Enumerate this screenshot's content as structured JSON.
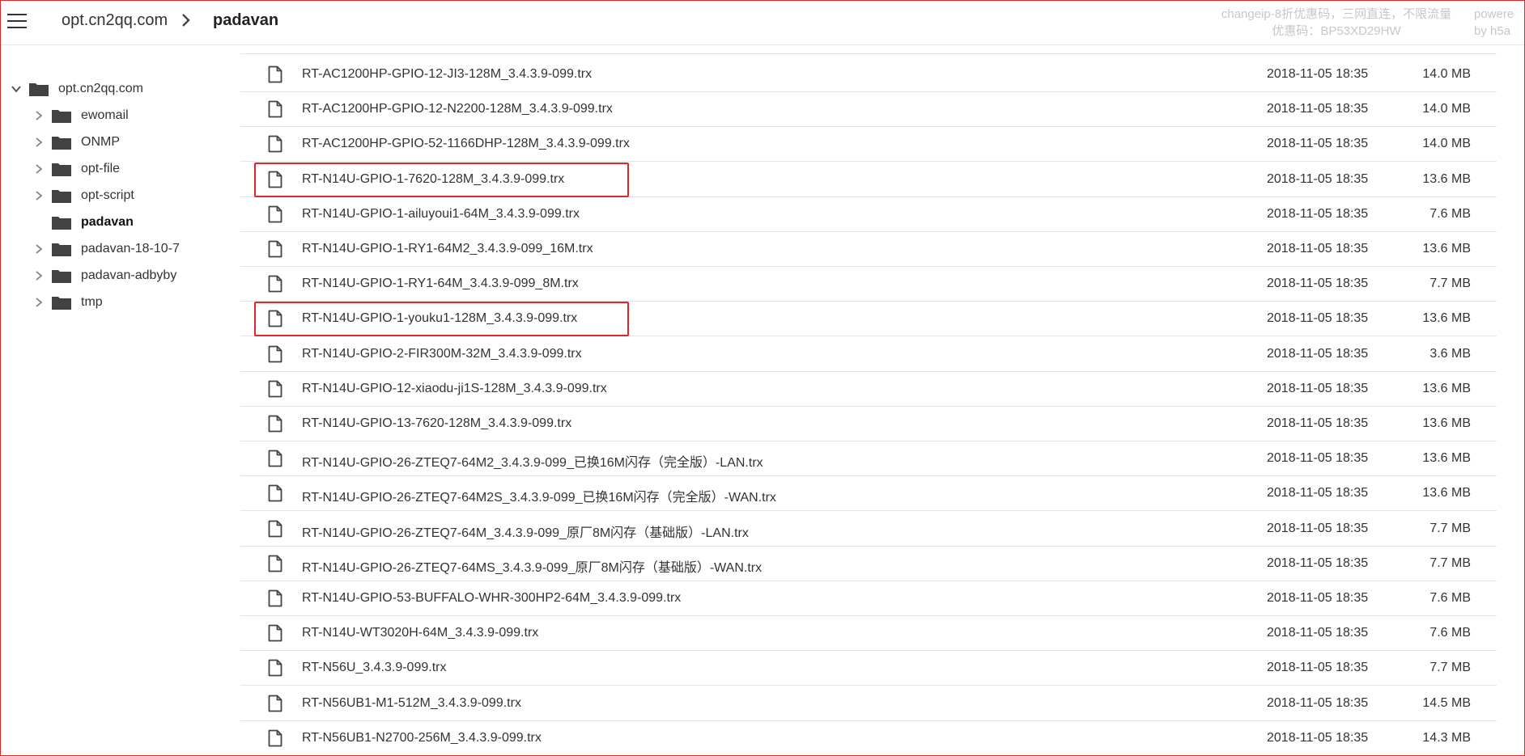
{
  "header": {
    "menu_icon": "hamburger-menu-icon",
    "breadcrumb_root": "opt.cn2qq.com",
    "breadcrumb_separator_icon": "chevron-right-icon",
    "breadcrumb_current": "padavan",
    "promo_line1": "changeip-8折优惠码，三网直连，不限流量",
    "promo_line2": "优惠码：BP53XD29HW",
    "powered_line1": "powere",
    "powered_line2": "by h5a"
  },
  "tree": {
    "root": {
      "label": "opt.cn2qq.com",
      "expanded": true
    },
    "children": [
      {
        "label": "ewomail"
      },
      {
        "label": "ONMP"
      },
      {
        "label": "opt-file"
      },
      {
        "label": "opt-script"
      },
      {
        "label": "padavan",
        "selected": true
      },
      {
        "label": "padavan-18-10-7"
      },
      {
        "label": "padavan-adbyby"
      },
      {
        "label": "tmp"
      }
    ]
  },
  "files": [
    {
      "name": "RT-AC1200HP-GPIO-12-JI3-128M_3.4.3.9-099.trx",
      "date": "2018-11-05 18:35",
      "size": "14.0 MB"
    },
    {
      "name": "RT-AC1200HP-GPIO-12-N2200-128M_3.4.3.9-099.trx",
      "date": "2018-11-05 18:35",
      "size": "14.0 MB"
    },
    {
      "name": "RT-AC1200HP-GPIO-52-1166DHP-128M_3.4.3.9-099.trx",
      "date": "2018-11-05 18:35",
      "size": "14.0 MB"
    },
    {
      "name": "RT-N14U-GPIO-1-7620-128M_3.4.3.9-099.trx",
      "date": "2018-11-05 18:35",
      "size": "13.6 MB",
      "highlighted": true
    },
    {
      "name": "RT-N14U-GPIO-1-ailuyoui1-64M_3.4.3.9-099.trx",
      "date": "2018-11-05 18:35",
      "size": "7.6 MB"
    },
    {
      "name": "RT-N14U-GPIO-1-RY1-64M2_3.4.3.9-099_16M.trx",
      "date": "2018-11-05 18:35",
      "size": "13.6 MB"
    },
    {
      "name": "RT-N14U-GPIO-1-RY1-64M_3.4.3.9-099_8M.trx",
      "date": "2018-11-05 18:35",
      "size": "7.7 MB"
    },
    {
      "name": "RT-N14U-GPIO-1-youku1-128M_3.4.3.9-099.trx",
      "date": "2018-11-05 18:35",
      "size": "13.6 MB",
      "highlighted": true
    },
    {
      "name": "RT-N14U-GPIO-2-FIR300M-32M_3.4.3.9-099.trx",
      "date": "2018-11-05 18:35",
      "size": "3.6 MB"
    },
    {
      "name": "RT-N14U-GPIO-12-xiaodu-ji1S-128M_3.4.3.9-099.trx",
      "date": "2018-11-05 18:35",
      "size": "13.6 MB"
    },
    {
      "name": "RT-N14U-GPIO-13-7620-128M_3.4.3.9-099.trx",
      "date": "2018-11-05 18:35",
      "size": "13.6 MB"
    },
    {
      "name": "RT-N14U-GPIO-26-ZTEQ7-64M2_3.4.3.9-099_已换16M闪存（完全版）-LAN.trx",
      "date": "2018-11-05 18:35",
      "size": "13.6 MB"
    },
    {
      "name": "RT-N14U-GPIO-26-ZTEQ7-64M2S_3.4.3.9-099_已换16M闪存（完全版）-WAN.trx",
      "date": "2018-11-05 18:35",
      "size": "13.6 MB"
    },
    {
      "name": "RT-N14U-GPIO-26-ZTEQ7-64M_3.4.3.9-099_原厂8M闪存（基础版）-LAN.trx",
      "date": "2018-11-05 18:35",
      "size": "7.7 MB"
    },
    {
      "name": "RT-N14U-GPIO-26-ZTEQ7-64MS_3.4.3.9-099_原厂8M闪存（基础版）-WAN.trx",
      "date": "2018-11-05 18:35",
      "size": "7.7 MB"
    },
    {
      "name": "RT-N14U-GPIO-53-BUFFALO-WHR-300HP2-64M_3.4.3.9-099.trx",
      "date": "2018-11-05 18:35",
      "size": "7.6 MB"
    },
    {
      "name": "RT-N14U-WT3020H-64M_3.4.3.9-099.trx",
      "date": "2018-11-05 18:35",
      "size": "7.6 MB"
    },
    {
      "name": "RT-N56U_3.4.3.9-099.trx",
      "date": "2018-11-05 18:35",
      "size": "7.7 MB"
    },
    {
      "name": "RT-N56UB1-M1-512M_3.4.3.9-099.trx",
      "date": "2018-11-05 18:35",
      "size": "14.5 MB"
    },
    {
      "name": "RT-N56UB1-N2700-256M_3.4.3.9-099.trx",
      "date": "2018-11-05 18:35",
      "size": "14.3 MB"
    }
  ],
  "colors": {
    "highlight": "#e0262b",
    "text": "#333333",
    "muted": "#c7c7c7"
  }
}
